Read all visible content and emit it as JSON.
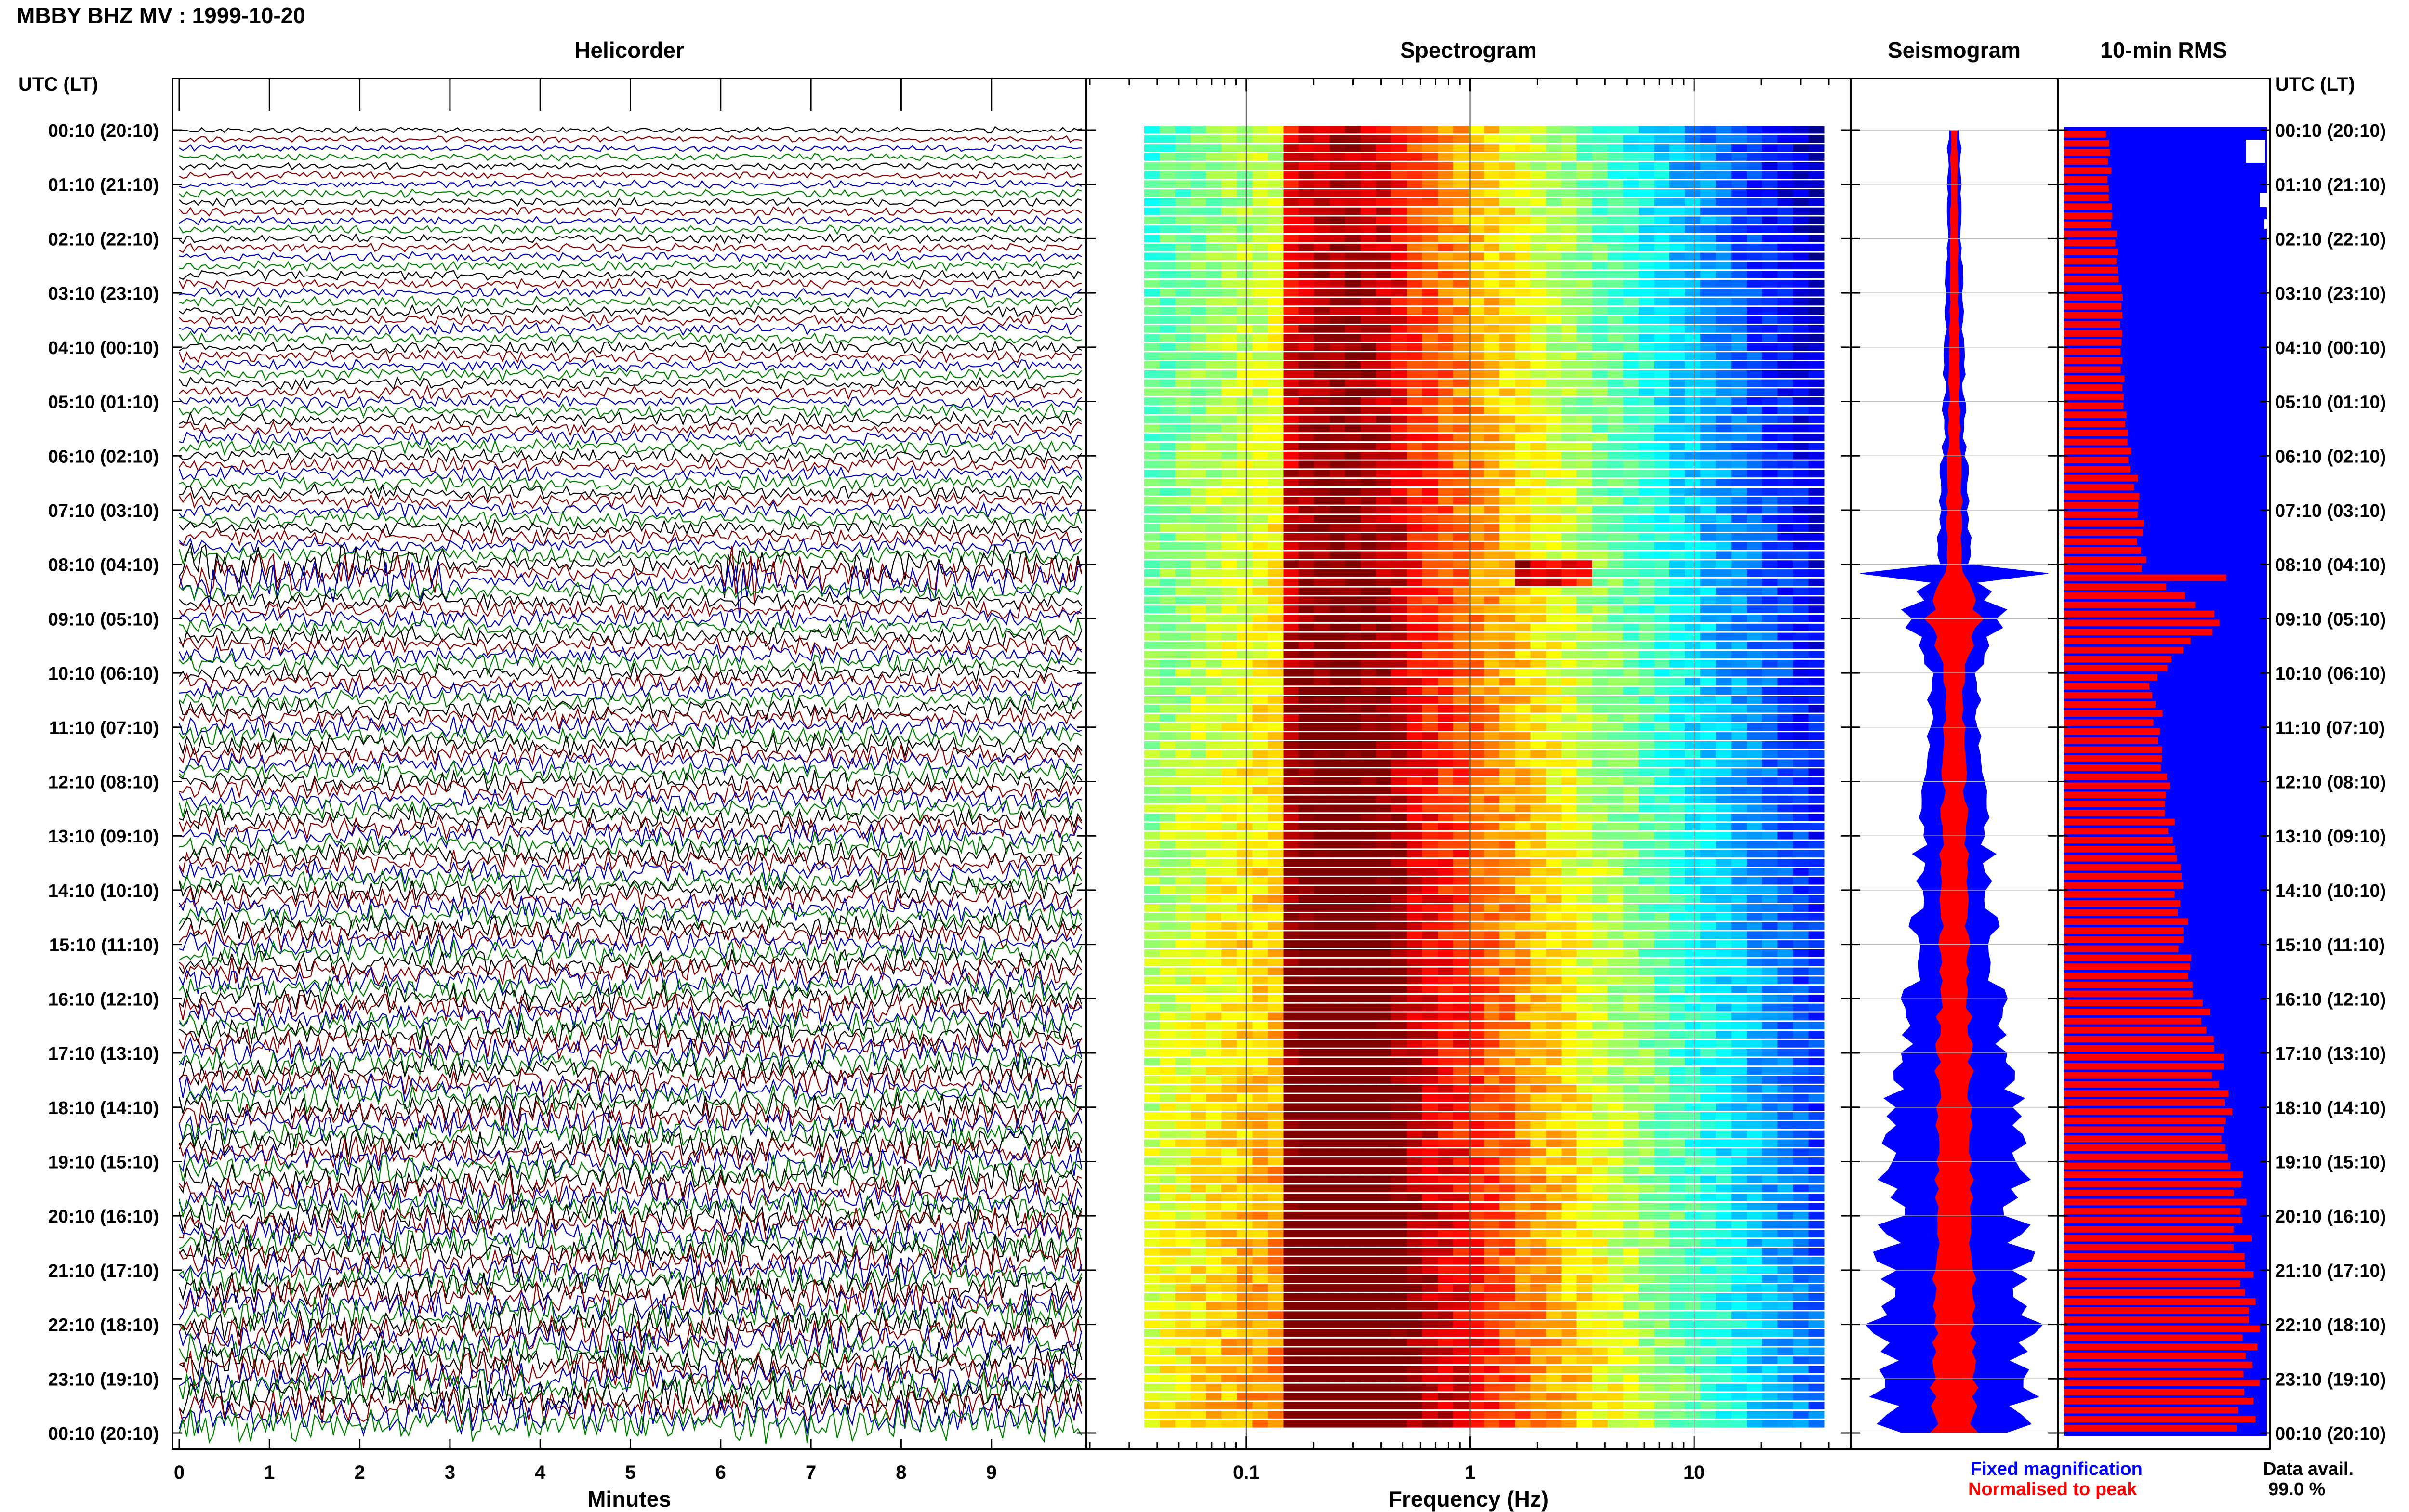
{
  "header": {
    "title": "MBBY BHZ MV : 1999-10-20"
  },
  "panels": {
    "helicorder": "Helicorder",
    "spectrogram": "Spectrogram",
    "seismogram": "Seismogram",
    "rms": "10-min RMS"
  },
  "time_axis": {
    "label": "UTC (LT)",
    "ticks": [
      "00:10 (20:10)",
      "01:10 (21:10)",
      "02:10 (22:10)",
      "03:10 (23:10)",
      "04:10 (00:10)",
      "05:10 (01:10)",
      "06:10 (02:10)",
      "07:10 (03:10)",
      "08:10 (04:10)",
      "09:10 (05:10)",
      "10:10 (06:10)",
      "11:10 (07:10)",
      "12:10 (08:10)",
      "13:10 (09:10)",
      "14:10 (10:10)",
      "15:10 (11:10)",
      "16:10 (12:10)",
      "17:10 (13:10)",
      "18:10 (14:10)",
      "19:10 (15:10)",
      "20:10 (16:10)",
      "21:10 (17:10)",
      "22:10 (18:10)",
      "23:10 (19:10)",
      "00:10 (20:10)"
    ]
  },
  "x_axes": {
    "minutes_label": "Minutes",
    "minutes_ticks": [
      "0",
      "1",
      "2",
      "3",
      "4",
      "5",
      "6",
      "7",
      "8",
      "9"
    ],
    "frequency_label": "Frequency (Hz)",
    "frequency_ticks": [
      "0.1",
      "1",
      "10"
    ]
  },
  "legend": {
    "fixed": "Fixed magnification",
    "normalised": "Normalised to peak",
    "fixed_color": "#0000ff",
    "normalised_color": "#ff0000"
  },
  "availability": {
    "label": "Data avail.",
    "value": "99.0 %"
  },
  "colors": {
    "helicorder_traces": [
      "#000000",
      "#8b0000",
      "#0000b4",
      "#008000"
    ],
    "spectrogram_colormap": "jet",
    "rms_background": "#0000ff",
    "rms_bars": "#ff0000"
  },
  "chart_data": [
    {
      "type": "line",
      "title": "Helicorder",
      "xlabel": "Minutes",
      "xlim": [
        0,
        10
      ],
      "rows": 144,
      "note_events": [
        {
          "time_utc": "08:10",
          "minute_range": [
            0,
            3
          ],
          "level": "high"
        },
        {
          "time_utc": "08:10",
          "minute_range": [
            6,
            10
          ],
          "level": "high"
        }
      ]
    },
    {
      "type": "heatmap",
      "title": "Spectrogram",
      "xlabel": "Frequency (Hz)",
      "xscale": "log",
      "xlim": [
        0.02,
        50
      ],
      "rows": 144,
      "peak_frequency_hz": [
        0.15,
        0.5
      ],
      "max_frequency_hz": 38
    },
    {
      "type": "area",
      "title": "Seismogram",
      "series": [
        {
          "name": "Fixed magnification",
          "color": "#0000ff",
          "halfwidth_by_hour": [
            0.06,
            0.06,
            0.07,
            0.08,
            0.09,
            0.1,
            0.12,
            0.15,
            0.17,
            0.5,
            0.22,
            0.24,
            0.28,
            0.33,
            0.38,
            0.42,
            0.45,
            0.52,
            0.6,
            0.62,
            0.66,
            0.68,
            0.75,
            0.73,
            0.7
          ]
        },
        {
          "name": "Normalised to peak",
          "color": "#ff0000",
          "halfwidth_by_hour": [
            0.03,
            0.03,
            0.035,
            0.04,
            0.045,
            0.05,
            0.06,
            0.07,
            0.08,
            0.25,
            0.09,
            0.1,
            0.11,
            0.12,
            0.13,
            0.14,
            0.15,
            0.16,
            0.17,
            0.18,
            0.18,
            0.19,
            0.2,
            0.2,
            0.2
          ]
        }
      ]
    },
    {
      "type": "bar",
      "title": "10-min RMS",
      "orientation": "horizontal",
      "relative_rms_by_hour": [
        0.22,
        0.23,
        0.26,
        0.28,
        0.29,
        0.31,
        0.34,
        0.37,
        0.4,
        0.78,
        0.45,
        0.48,
        0.51,
        0.55,
        0.58,
        0.6,
        0.7,
        0.76,
        0.8,
        0.85,
        0.9,
        0.89,
        0.95,
        0.93,
        0.9
      ]
    }
  ]
}
